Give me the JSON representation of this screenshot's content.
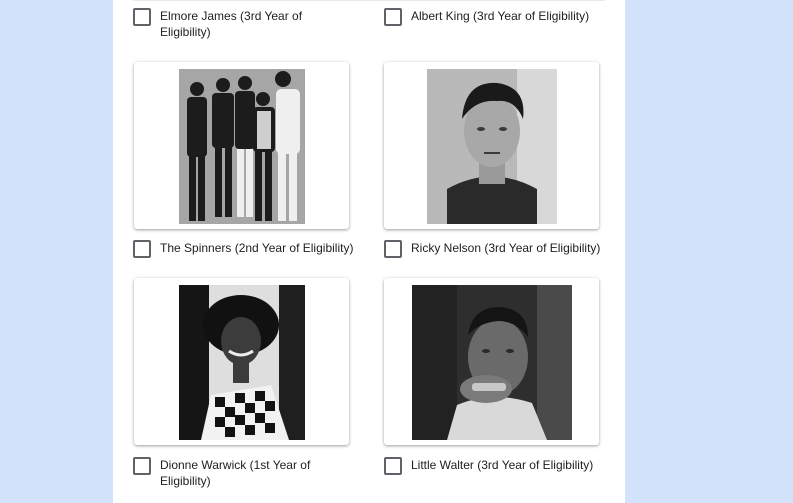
{
  "options": [
    {
      "label": "Elmore James (3rd Year of Eligibility)",
      "checked": false
    },
    {
      "label": "Albert King (3rd Year of Eligibility)",
      "checked": false
    },
    {
      "label": "The Spinners (2nd Year of Eligibility)",
      "checked": false
    },
    {
      "label": "Ricky Nelson (3rd Year of Eligibility)",
      "checked": false
    },
    {
      "label": "Dionne Warwick (1st Year of Eligibility)",
      "checked": false
    },
    {
      "label": "Little Walter (3rd Year of Eligibility)",
      "checked": false
    }
  ],
  "colors": {
    "page_background": "#d3e3fc",
    "card_background": "#ffffff",
    "checkbox_border": "#5f6368",
    "text": "#202124"
  }
}
